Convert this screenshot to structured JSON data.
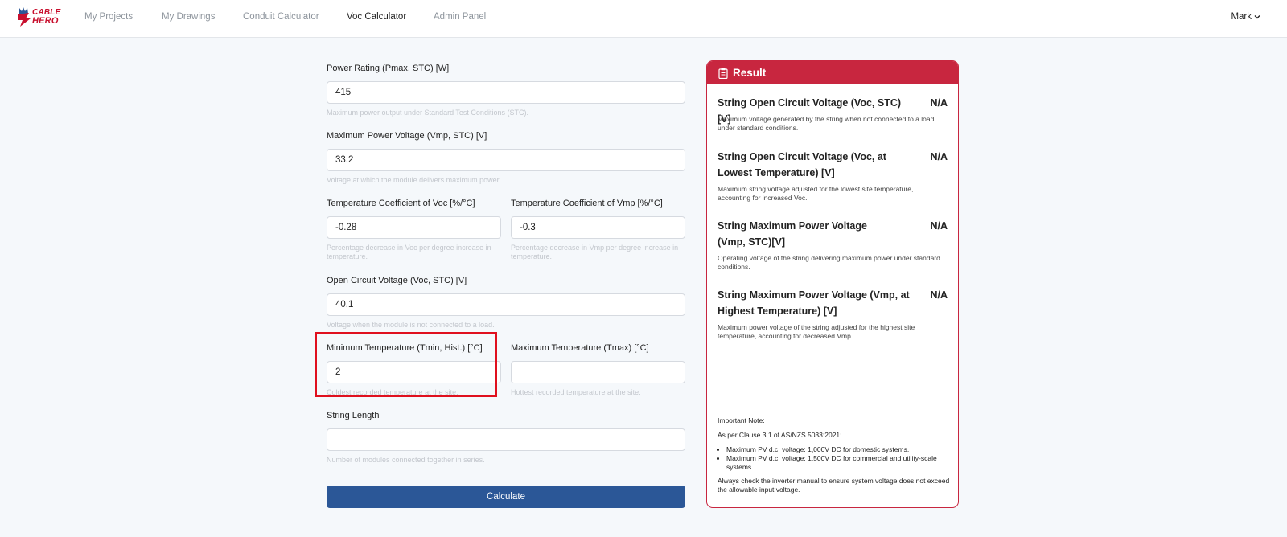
{
  "brand": {
    "line1": "CABLE",
    "line2": "HERO"
  },
  "nav": {
    "items": [
      {
        "label": "My Projects"
      },
      {
        "label": "My Drawings"
      },
      {
        "label": "Conduit Calculator"
      },
      {
        "label": "Voc Calculator"
      },
      {
        "label": "Admin Panel"
      }
    ],
    "active_index": 3,
    "user": "Mark"
  },
  "form": {
    "pmax": {
      "label": "Power Rating (Pmax, STC) [W]",
      "value": "415",
      "help": "Maximum power output under Standard Test Conditions (STC)."
    },
    "vmp": {
      "label": "Maximum Power Voltage (Vmp, STC) [V]",
      "value": "33.2",
      "help": "Voltage at which the module delivers maximum power."
    },
    "temp_coeff_voc": {
      "label": "Temperature Coefficient of Voc [%/°C]",
      "value": "-0.28",
      "help": "Percentage decrease in Voc per degree increase in temperature."
    },
    "temp_coeff_vmp": {
      "label": "Temperature Coefficient of Vmp [%/°C]",
      "value": "-0.3",
      "help": "Percentage decrease in Vmp per degree increase in temperature."
    },
    "voc": {
      "label": "Open Circuit Voltage (Voc, STC) [V]",
      "value": "40.1",
      "help": "Voltage when the module is not connected to a load."
    },
    "tmin": {
      "label": "Minimum Temperature (Tmin, Hist.) [°C]",
      "value": "2",
      "help": "Coldest recorded temperature at the site."
    },
    "tmax": {
      "label": "Maximum Temperature (Tmax) [°C]",
      "value": "",
      "help": "Hottest recorded temperature at the site."
    },
    "string_length": {
      "label": "String Length",
      "value": "",
      "help": "Number of modules connected together in series."
    },
    "calculate_label": "Calculate"
  },
  "result": {
    "title": "Result",
    "items": [
      {
        "title": "String Open Circuit Voltage (Voc, STC)[V]",
        "value": "N/A",
        "desc": "Maximum voltage generated by the string when not connected to a load under standard conditions."
      },
      {
        "title": "String Open Circuit Voltage (Voc, at Lowest Temperature) [V]",
        "value": "N/A",
        "desc": "Maximum string voltage adjusted for the lowest site temperature, accounting for increased Voc."
      },
      {
        "title": "String Maximum Power Voltage (Vmp, STC)[V]",
        "value": "N/A",
        "desc": "Operating voltage of the string delivering maximum power under standard conditions."
      },
      {
        "title": "String Maximum Power Voltage (Vmp, at Highest Temperature) [V]",
        "value": "N/A",
        "desc": "Maximum power voltage of the string adjusted for the highest site temperature, accounting for decreased Vmp."
      }
    ],
    "note": {
      "heading": "Important Note:",
      "clause": "As per Clause 3.1 of AS/NZS 5033:2021:",
      "bullets": [
        "Maximum PV d.c. voltage: 1,000V DC for domestic systems.",
        "Maximum PV d.c. voltage: 1,500V DC for commercial and utility-scale systems."
      ],
      "footer": "Always check the inverter manual to ensure system voltage does not exceed the allowable input voltage."
    }
  },
  "colors": {
    "brand_red": "#c8263f",
    "primary_blue": "#2b5797",
    "highlight_red": "#e0101e"
  },
  "icons": [
    "logo-icon",
    "chevron-down-icon",
    "clipboard-icon"
  ]
}
